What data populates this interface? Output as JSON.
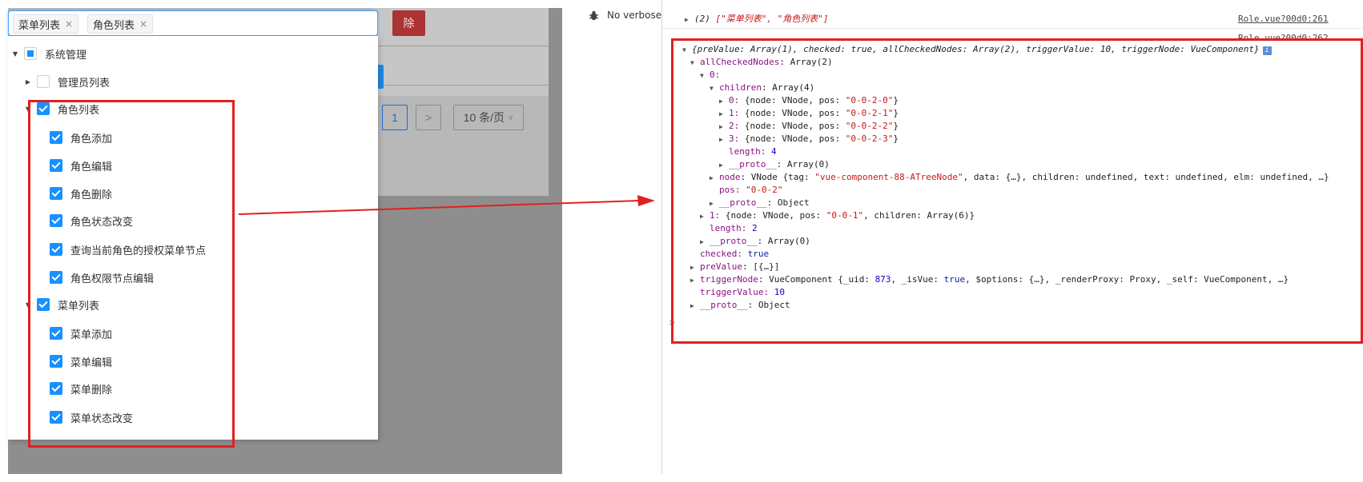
{
  "app": {
    "delete_label": "除",
    "pager": {
      "current_page": "1",
      "next_icon": ">",
      "page_size": "10 条/页"
    },
    "tree_select": {
      "tags": [
        {
          "label": "菜单列表",
          "close": "×"
        },
        {
          "label": "角色列表",
          "close": "×"
        }
      ],
      "nodes": [
        {
          "label": "系统管理",
          "state": "half",
          "expanded": true,
          "level": 0
        },
        {
          "label": "管理员列表",
          "state": "off",
          "expanded": false,
          "level": 1
        },
        {
          "label": "角色列表",
          "state": "on",
          "expanded": true,
          "level": 1
        },
        {
          "label": "角色添加",
          "state": "on",
          "level": 2
        },
        {
          "label": "角色编辑",
          "state": "on",
          "level": 2
        },
        {
          "label": "角色删除",
          "state": "on",
          "level": 2
        },
        {
          "label": "角色状态改变",
          "state": "on",
          "level": 2
        },
        {
          "label": "查询当前角色的授权菜单节点",
          "state": "on",
          "level": 2
        },
        {
          "label": "角色权限节点编辑",
          "state": "on",
          "level": 2
        },
        {
          "label": "菜单列表",
          "state": "on",
          "expanded": true,
          "level": 1
        },
        {
          "label": "菜单添加",
          "state": "on",
          "level": 2
        },
        {
          "label": "菜单编辑",
          "state": "on",
          "level": 2
        },
        {
          "label": "菜单删除",
          "state": "on",
          "level": 2
        },
        {
          "label": "菜单状态改变",
          "state": "on",
          "level": 2
        }
      ]
    }
  },
  "devtools": {
    "verbose_label": "No verbose",
    "log1": {
      "count": "(2)",
      "value": "[\"菜单列表\", \"角色列表\"]",
      "source": "Role.vue?00d0:261"
    },
    "log2": {
      "source": "Role.vue?00d0:262"
    },
    "obj": {
      "summary": "{preValue: Array(1), checked: true, allCheckedNodes: Array(2), triggerValue: 10, triggerNode: VueComponent}",
      "info_icon": "i",
      "all_checked_key": "allCheckedNodes",
      "all_checked_val": "Array(2)",
      "idx0": "0:",
      "children_key": "children",
      "children_val": "Array(4)",
      "child_items": [
        {
          "key": "0:",
          "node": "{node: VNode, pos: ",
          "pos": "\"0-0-2-0\"",
          "end": "}"
        },
        {
          "key": "1:",
          "node": "{node: VNode, pos: ",
          "pos": "\"0-0-2-1\"",
          "end": "}"
        },
        {
          "key": "2:",
          "node": "{node: VNode, pos: ",
          "pos": "\"0-0-2-2\"",
          "end": "}"
        },
        {
          "key": "3:",
          "node": "{node: VNode, pos: ",
          "pos": "\"0-0-2-3\"",
          "end": "}"
        }
      ],
      "children_length_key": "length:",
      "children_length_val": "4",
      "proto_key": "__proto__",
      "children_proto_val": ": Array(0)",
      "node_key": "node",
      "node_val_a": ": VNode {tag: ",
      "node_val_tag": "\"vue-component-88-ATreeNode\"",
      "node_val_b": ", data: {…}, children: undefined, text: undefined, elm: undefined, …}",
      "pos_key": "pos:",
      "pos_val": "\"0-0-2\"",
      "obj_proto_val": ": Object",
      "idx1_key": "1:",
      "idx1_a": "{node: VNode, pos: ",
      "idx1_pos": "\"0-0-1\"",
      "idx1_b": ", children: Array(6)}",
      "arr_length_key": "length:",
      "arr_length_val": "2",
      "arr_proto_val": ": Array(0)",
      "checked_key": "checked:",
      "checked_val": "true",
      "prevalue_key": "preValue",
      "prevalue_val": ": [{…}]",
      "trigger_node_key": "triggerNode",
      "trigger_node_a": ": VueComponent {_uid: ",
      "trigger_node_uid": "873",
      "trigger_node_b": ", _isVue: ",
      "trigger_node_true": "true",
      "trigger_node_c": ", $options: {…}, _renderProxy: Proxy, _self: VueComponent, …}",
      "trigger_value_key": "triggerValue:",
      "trigger_value_val": "10",
      "root_proto_val": ": Object"
    },
    "prompt": ">"
  },
  "colors": {
    "highlight_red": "#e02020",
    "primary_blue": "#1890ff"
  }
}
